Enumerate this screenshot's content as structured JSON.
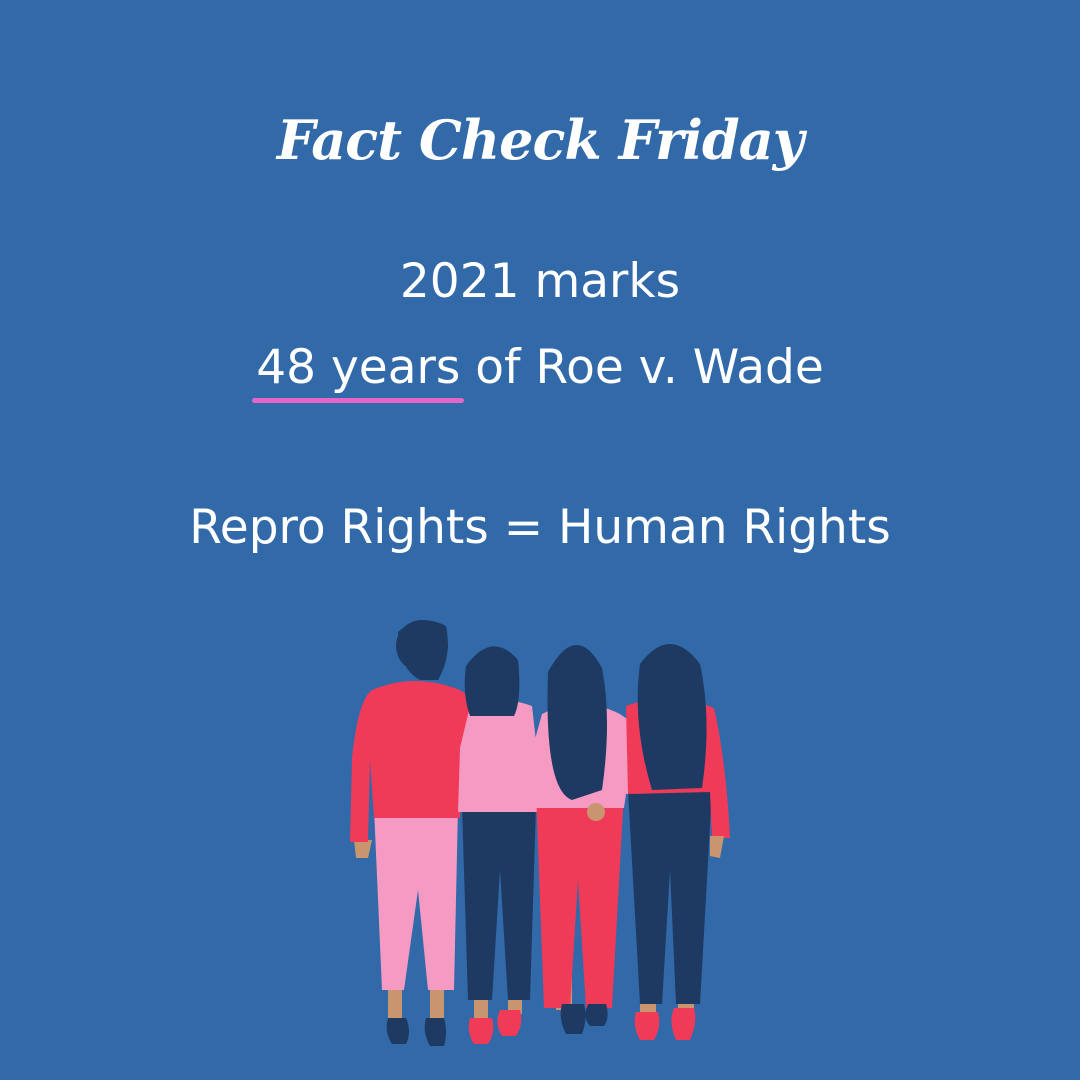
{
  "title": "Fact Check Friday",
  "line1": "2021 marks",
  "line2": {
    "highlight": "48 years",
    "rest": " of Roe v. Wade"
  },
  "line3": "Repro Rights = Human Rights",
  "illustration": {
    "icon": "four-women-embracing-from-behind-illustration"
  },
  "colors": {
    "background": "#3169A9",
    "text": "#FFFFFF",
    "underline": "#E466C9",
    "hair": "#1E3A63",
    "red_top": "#F03B58",
    "pink_top": "#F59AC3",
    "denim": "#1E3A63",
    "skin": "#C9956E"
  }
}
